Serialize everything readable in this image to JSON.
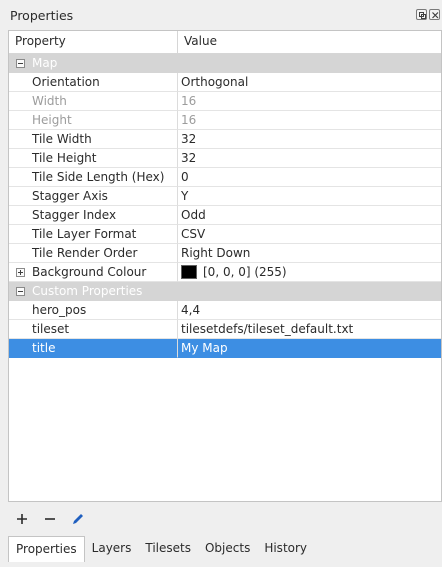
{
  "window": {
    "title": "Properties"
  },
  "header": {
    "property": "Property",
    "value": "Value"
  },
  "groups": {
    "map": "Map",
    "custom": "Custom Properties"
  },
  "map_rows": [
    {
      "name": "Orientation",
      "value": "Orthogonal",
      "disabled": false
    },
    {
      "name": "Width",
      "value": "16",
      "disabled": true
    },
    {
      "name": "Height",
      "value": "16",
      "disabled": true
    },
    {
      "name": "Tile Width",
      "value": "32",
      "disabled": false
    },
    {
      "name": "Tile Height",
      "value": "32",
      "disabled": false
    },
    {
      "name": "Tile Side Length (Hex)",
      "value": "0",
      "disabled": false
    },
    {
      "name": "Stagger Axis",
      "value": "Y",
      "disabled": false
    },
    {
      "name": "Stagger Index",
      "value": "Odd",
      "disabled": false
    },
    {
      "name": "Tile Layer Format",
      "value": "CSV",
      "disabled": false
    },
    {
      "name": "Tile Render Order",
      "value": "Right Down",
      "disabled": false
    }
  ],
  "background_colour": {
    "name": "Background Colour",
    "value": "[0, 0, 0] (255)",
    "color": "#000000"
  },
  "custom_rows": [
    {
      "name": "hero_pos",
      "value": "4,4"
    },
    {
      "name": "tileset",
      "value": "tilesetdefs/tileset_default.txt"
    },
    {
      "name": "title",
      "value": "My Map",
      "selected": true
    }
  ],
  "toolbar": {
    "add": "add-icon",
    "remove": "remove-icon",
    "edit": "edit-icon"
  },
  "tabs": [
    {
      "label": "Properties",
      "active": true
    },
    {
      "label": "Layers",
      "active": false
    },
    {
      "label": "Tilesets",
      "active": false
    },
    {
      "label": "Objects",
      "active": false
    },
    {
      "label": "History",
      "active": false
    }
  ],
  "colors": {
    "selection": "#3d8ee3",
    "group_header": "#d5d5d5",
    "edit_icon": "#1f5fbf"
  }
}
